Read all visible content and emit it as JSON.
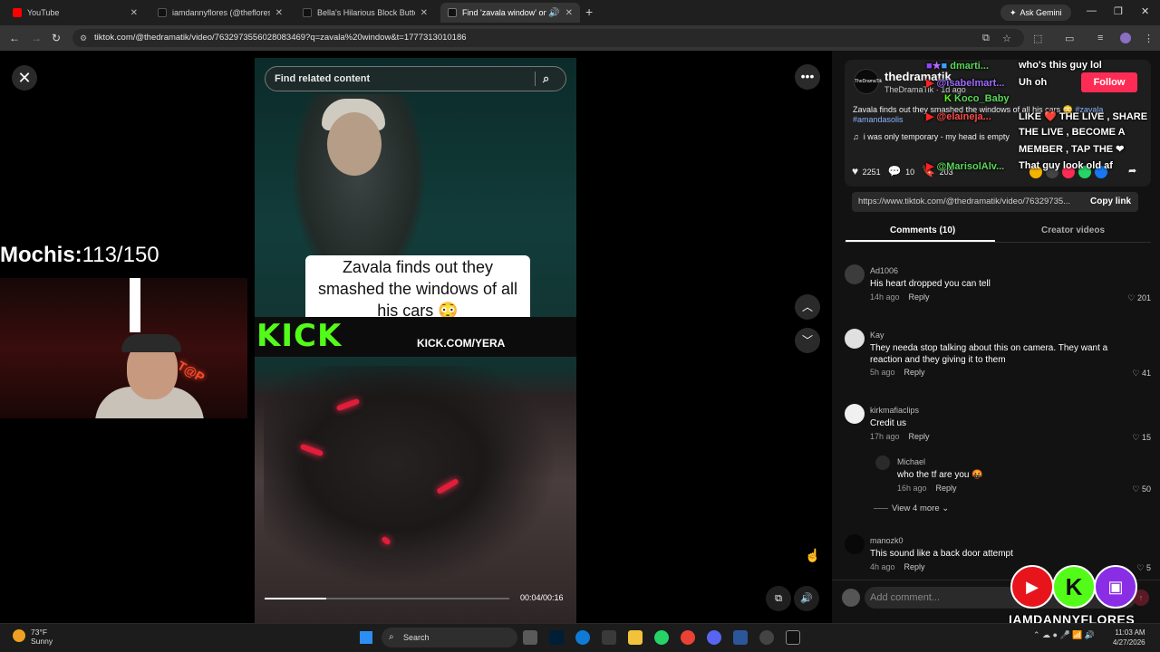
{
  "browser": {
    "tabs": [
      {
        "title": "YouTube",
        "color": "#ff0000",
        "active": false
      },
      {
        "title": "iamdannyflores (@thefloresrep",
        "color": "#111111",
        "active": false
      },
      {
        "title": "Bella's Hilarious Block Button M",
        "color": "#111111",
        "active": false
      },
      {
        "title": "Find 'zavala window' on Tik",
        "color": "#111111",
        "active": true
      }
    ],
    "ask_gemini": "Ask Gemini",
    "url": "tiktok.com/@thedramatik/video/7632973556028083469?q=zavala%20window&t=1777313010186"
  },
  "video": {
    "search_placeholder": "Find related content",
    "caption": "Zavala finds out they smashed the windows of all his cars 😳",
    "kick_logo": "KICK",
    "kick_url": "KICK.COM/YERA",
    "timecode": "00:04/00:16",
    "progress": 0.25
  },
  "overlay": {
    "mochis_label": "Mochis:",
    "mochis_count": "113/150",
    "handle": "IAMDANNYFLORES"
  },
  "post": {
    "username": "thedramatik",
    "display": "TheDramaTik",
    "age": "1d ago",
    "follow": "Follow",
    "description": "Zavala finds out they smashed the windows of all his cars 😳",
    "tag1": "#zavala",
    "tag2": "#amandasolis",
    "music": "i was only temporary - my head is empty",
    "likes": "2251",
    "comments": "10",
    "saves": "203",
    "link": "https://www.tiktok.com/@thedramatik/video/76329735...",
    "copy_link": "Copy link"
  },
  "panel_tabs": {
    "comments": "Comments (10)",
    "creator": "Creator videos"
  },
  "comments": [
    {
      "user": "Ad1006",
      "text": "His heart dropped you can tell",
      "age": "14h ago",
      "reply": "Reply",
      "likes": "201"
    },
    {
      "user": "Kay",
      "text": "They needa stop talking about this on camera. They want a reaction and they giving it to them",
      "age": "5h ago",
      "reply": "Reply",
      "likes": "41"
    },
    {
      "user": "kirkmafiaclips",
      "text": "Credit us",
      "age": "17h ago",
      "reply": "Reply",
      "likes": "15"
    },
    {
      "user": "Michael",
      "text": "who the tf are you 🤬",
      "age": "16h ago",
      "reply": "Reply",
      "likes": "50"
    },
    {
      "user": "manozk0",
      "text": "This sound like a back door attempt",
      "age": "4h ago",
      "reply": "Reply",
      "likes": "5"
    }
  ],
  "view_more": "View 4 more",
  "add_comment": "Add comment...",
  "chat": {
    "users": [
      {
        "name": "dmarti...",
        "color": "#58d858"
      },
      {
        "name": "@isabelmart...",
        "color": "#9b6bff"
      },
      {
        "name": "Koco_Baby",
        "color": "#58d858"
      },
      {
        "name": "@elaineja...",
        "color": "#ff4a4a"
      },
      {
        "name": "@MarisolAlv...",
        "color": "#58d858"
      }
    ],
    "messages": [
      "who's this guy lol",
      "Uh oh",
      "LIKE ❤️ THE LIVE , SHARE",
      "THE LIVE , BECOME A",
      "MEMBER , TAP THE ❤",
      "That guy look old af"
    ]
  },
  "taskbar": {
    "temp": "73°F",
    "condition": "Sunny",
    "search": "Search",
    "time": "11:03 AM",
    "date": "4/27/2026"
  }
}
